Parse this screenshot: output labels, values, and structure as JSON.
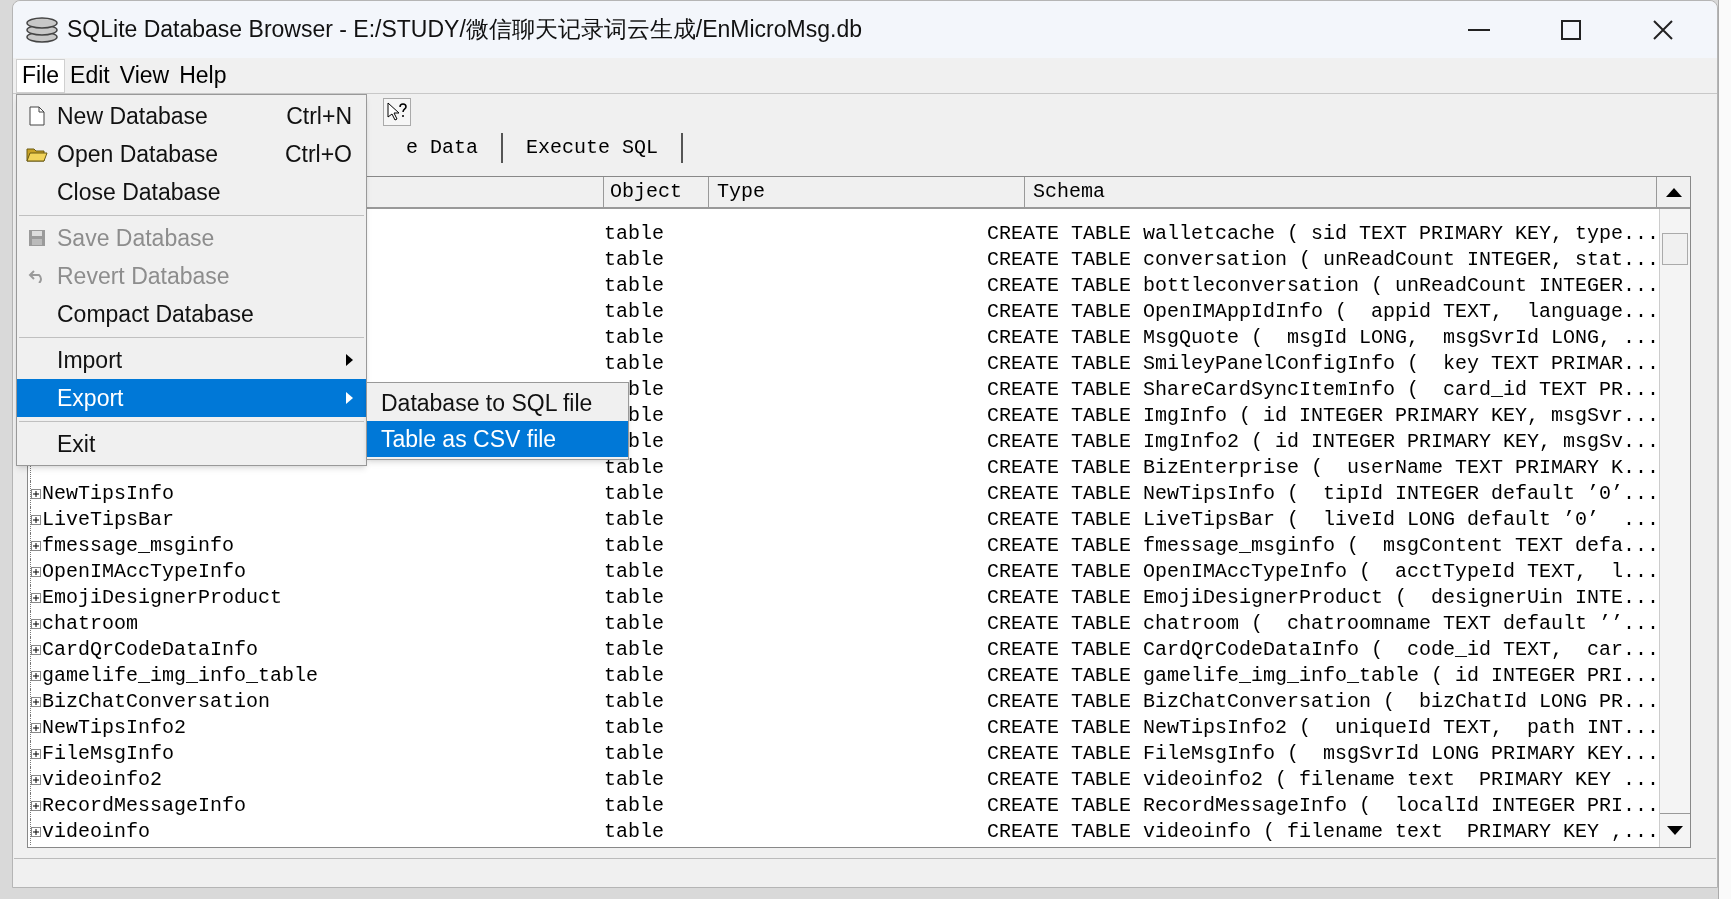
{
  "window": {
    "title": "SQLite Database Browser - E:/STUDY/微信聊天记录词云生成/EnMicroMsg.db"
  },
  "menu_bar": [
    {
      "label": "File",
      "selected": true
    },
    {
      "label": "Edit",
      "selected": false
    },
    {
      "label": "View",
      "selected": false
    },
    {
      "label": "Help",
      "selected": false
    }
  ],
  "file_menu": [
    {
      "kind": "item",
      "label": "New Database",
      "shortcut": "Ctrl+N",
      "disabled": false,
      "selected": false,
      "submenu": false
    },
    {
      "kind": "item",
      "label": "Open Database",
      "shortcut": "Ctrl+O",
      "disabled": false,
      "selected": false,
      "submenu": false
    },
    {
      "kind": "item",
      "label": "Close Database",
      "disabled": false,
      "selected": false,
      "submenu": false
    },
    {
      "kind": "separator"
    },
    {
      "kind": "item",
      "label": "Save Database",
      "disabled": true,
      "selected": false,
      "submenu": false
    },
    {
      "kind": "item",
      "label": "Revert Database",
      "disabled": true,
      "selected": false,
      "submenu": false
    },
    {
      "kind": "item",
      "label": "Compact Database",
      "disabled": false,
      "selected": false,
      "submenu": false
    },
    {
      "kind": "separator"
    },
    {
      "kind": "item",
      "label": "Import",
      "disabled": false,
      "selected": false,
      "submenu": true
    },
    {
      "kind": "item",
      "label": "Export",
      "disabled": false,
      "selected": true,
      "submenu": true
    },
    {
      "kind": "separator"
    },
    {
      "kind": "item",
      "label": "Exit",
      "disabled": false,
      "selected": false,
      "submenu": false
    }
  ],
  "export_submenu": [
    {
      "label": "Database to SQL file",
      "selected": false
    },
    {
      "label": "Table as CSV file",
      "selected": true
    }
  ],
  "tabs": [
    {
      "label": "e Data",
      "selected": false
    },
    {
      "label": "Execute SQL",
      "selected": false
    }
  ],
  "table": {
    "columns": [
      "Object",
      "Type",
      "Schema"
    ],
    "rows": [
      {
        "object": "table",
        "schema": "CREATE TABLE walletcache ( sid TEXT PRIMARY KEY, type..."
      },
      {
        "object": "table",
        "schema": "CREATE TABLE conversation ( unReadCount INTEGER, stat..."
      },
      {
        "object": "table",
        "schema": "CREATE TABLE bottleconversation ( unReadCount INTEGER..."
      },
      {
        "object": "table",
        "schema": "CREATE TABLE OpenIMAppIdInfo (  appid TEXT,  language..."
      },
      {
        "object": "table",
        "schema": "CREATE TABLE MsgQuote (  msgId LONG,  msgSvrId LONG, ..."
      },
      {
        "object": "table",
        "schema": "CREATE TABLE SmileyPanelConfigInfo (  key TEXT PRIMAR..."
      },
      {
        "object": "ble",
        "object_covered": true,
        "schema": "CREATE TABLE ShareCardSyncItemInfo (  card_id TEXT PR..."
      },
      {
        "object": "ble",
        "object_covered": true,
        "schema": "CREATE TABLE ImgInfo ( id INTEGER PRIMARY KEY, msgSvr..."
      },
      {
        "object": "ble",
        "object_covered": true,
        "schema": "CREATE TABLE ImgInfo2 ( id INTEGER PRIMARY KEY, msgSv..."
      },
      {
        "object": "table",
        "schema": "CREATE TABLE BizEnterprise (  userName TEXT PRIMARY K..."
      },
      {
        "name": "NewTipsInfo",
        "object": "table",
        "schema": "CREATE TABLE NewTipsInfo (  tipId INTEGER default ’0’..."
      },
      {
        "name": "LiveTipsBar",
        "object": "table",
        "schema": "CREATE TABLE LiveTipsBar (  liveId LONG default ’0’  ..."
      },
      {
        "name": "fmessage_msginfo",
        "object": "table",
        "schema": "CREATE TABLE fmessage_msginfo (  msgContent TEXT defa..."
      },
      {
        "name": "OpenIMAccTypeInfo",
        "object": "table",
        "schema": "CREATE TABLE OpenIMAccTypeInfo (  acctTypeId TEXT,  l..."
      },
      {
        "name": "EmojiDesignerProduct",
        "object": "table",
        "schema": "CREATE TABLE EmojiDesignerProduct (  designerUin INTE..."
      },
      {
        "name": "chatroom",
        "object": "table",
        "schema": "CREATE TABLE chatroom (  chatroomname TEXT default ’’..."
      },
      {
        "name": "CardQrCodeDataInfo",
        "object": "table",
        "schema": "CREATE TABLE CardQrCodeDataInfo (  code_id TEXT,  car..."
      },
      {
        "name": "gamelife_img_info_table",
        "object": "table",
        "schema": "CREATE TABLE gamelife_img_info_table ( id INTEGER PRI..."
      },
      {
        "name": "BizChatConversation",
        "object": "table",
        "schema": "CREATE TABLE BizChatConversation (  bizChatId LONG PR..."
      },
      {
        "name": "NewTipsInfo2",
        "object": "table",
        "schema": "CREATE TABLE NewTipsInfo2 (  uniqueId TEXT,  path INT..."
      },
      {
        "name": "FileMsgInfo",
        "object": "table",
        "schema": "CREATE TABLE FileMsgInfo (  msgSvrId LONG PRIMARY KEY..."
      },
      {
        "name": "videoinfo2",
        "object": "table",
        "schema": "CREATE TABLE videoinfo2 ( filename text  PRIMARY KEY ..."
      },
      {
        "name": "RecordMessageInfo",
        "object": "table",
        "schema": "CREATE TABLE RecordMessageInfo (  localId INTEGER PRI..."
      },
      {
        "name": "videoinfo",
        "object": "table",
        "schema": "CREATE TABLE videoinfo ( filename text  PRIMARY KEY ,..."
      }
    ]
  }
}
